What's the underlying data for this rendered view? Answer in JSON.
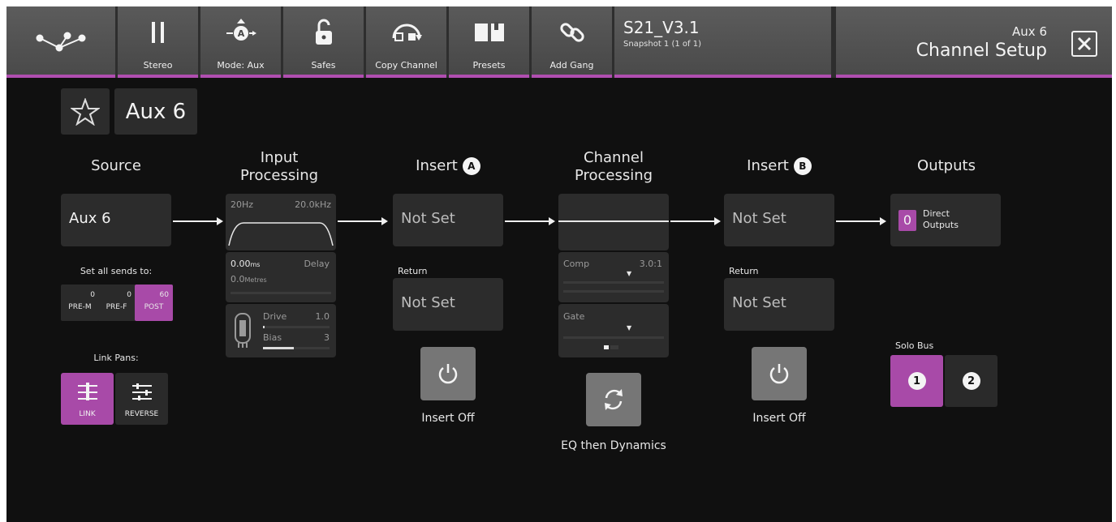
{
  "toolbar": {
    "items": [
      {
        "label": "",
        "icon": "routing-icon"
      },
      {
        "label": "Stereo",
        "icon": "stereo-icon"
      },
      {
        "label": "Mode: Aux",
        "icon": "mode-aux-icon"
      },
      {
        "label": "Safes",
        "icon": "padlock-icon"
      },
      {
        "label": "Copy Channel",
        "icon": "copy-channel-icon"
      },
      {
        "label": "Presets",
        "icon": "book-icon"
      },
      {
        "label": "Add Gang",
        "icon": "gang-link-icon"
      }
    ],
    "snapshot_name": "S21_V3.1",
    "snapshot_sub": "Snapshot 1 (1 of 1)",
    "channel_aux": "Aux 6",
    "channel_title": "Channel Setup"
  },
  "channel": {
    "name": "Aux 6"
  },
  "source": {
    "heading": "Source",
    "value": "Aux 6",
    "sends_label": "Set all sends to:",
    "sends": [
      {
        "name": "PRE-M",
        "value": "0",
        "active": false
      },
      {
        "name": "PRE-F",
        "value": "0",
        "active": false
      },
      {
        "name": "POST",
        "value": "60",
        "active": true
      }
    ],
    "link_pans_label": "Link Pans:",
    "link_buttons": [
      {
        "name": "LINK",
        "active": true
      },
      {
        "name": "REVERSE",
        "active": false
      }
    ]
  },
  "input_processing": {
    "heading1": "Input",
    "heading2": "Processing",
    "hpf": "20Hz",
    "lpf": "20.0kHz",
    "delay_ms": "0.00",
    "delay_ms_unit": "ms",
    "delay_label": "Delay",
    "delay_m": "0.0",
    "delay_m_unit": "Metres",
    "drive_label": "Drive",
    "drive_value": "1.0",
    "bias_label": "Bias",
    "bias_value": "3"
  },
  "insert_a": {
    "heading": "Insert",
    "badge": "A",
    "send": "Not Set",
    "return_label": "Return",
    "return": "Not Set",
    "state": "Insert Off"
  },
  "channel_processing": {
    "heading1": "Channel",
    "heading2": "Processing",
    "comp_label": "Comp",
    "comp_value": "3.0:1",
    "gate_label": "Gate",
    "order": "EQ then Dynamics"
  },
  "insert_b": {
    "heading": "Insert",
    "badge": "B",
    "send": "Not Set",
    "return_label": "Return",
    "return": "Not Set",
    "state": "Insert Off"
  },
  "outputs": {
    "heading": "Outputs",
    "count": "0",
    "label1": "Direct",
    "label2": "Outputs",
    "solo_label": "Solo Bus",
    "solo": [
      {
        "num": "1",
        "active": true
      },
      {
        "num": "2",
        "active": false
      }
    ]
  },
  "colors": {
    "accent": "#b04fb0",
    "background": "#101010",
    "panel": "#2c2c2c"
  }
}
